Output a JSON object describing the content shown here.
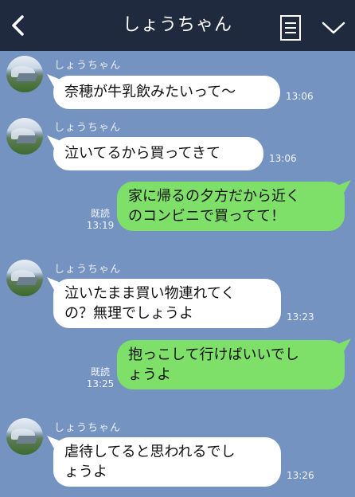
{
  "header": {
    "title": "しょうちゃん",
    "back_icon": "chevron-left-icon",
    "menu_icon": "document-list-icon",
    "more_icon": "chevron-down-icon",
    "background": "#1f2a3f"
  },
  "chat": {
    "background": "#7493c0",
    "incoming_bubble_color": "#ffffff",
    "outgoing_bubble_color": "#7fe069",
    "messages": [
      {
        "direction": "in",
        "sender": "しょうちゃん",
        "lines": [
          "奈穂が牛乳飲みたいって〜"
        ],
        "time": "13:06"
      },
      {
        "direction": "in",
        "sender": "しょうちゃん",
        "lines": [
          "泣いてるから買ってきて"
        ],
        "time": "13:06"
      },
      {
        "direction": "out",
        "lines": [
          "家に帰るの夕方だから近く",
          "のコンビニで買ってて！"
        ],
        "read": "既読",
        "time": "13:19"
      },
      {
        "direction": "in",
        "sender": "しょうちゃん",
        "lines": [
          "泣いたまま買い物連れてく",
          "の？無理でしょうよ"
        ],
        "time": "13:23"
      },
      {
        "direction": "out",
        "lines": [
          "抱っこして行けばいいでし",
          "ょうよ"
        ],
        "read": "既読",
        "time": "13:25"
      },
      {
        "direction": "in",
        "sender": "しょうちゃん",
        "lines": [
          "虐待してると思われるでし",
          "ょうよ"
        ],
        "time": "13:26"
      }
    ]
  }
}
